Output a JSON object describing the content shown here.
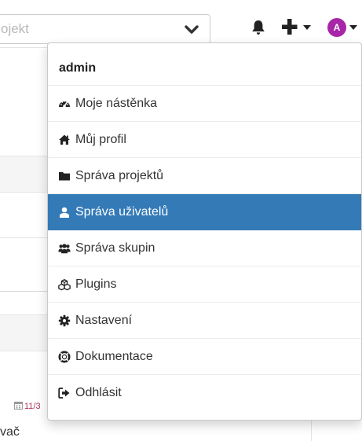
{
  "header": {
    "project_search": {
      "placeholder": "ojekt"
    },
    "avatar_initial": "A"
  },
  "background": {
    "date_fragment": "11/3",
    "text_fragment": "vač"
  },
  "user_menu": {
    "header": "admin",
    "items": [
      {
        "label": "Moje nástěnka",
        "icon": "dashboard-icon",
        "active": false
      },
      {
        "label": "Můj profil",
        "icon": "home-icon",
        "active": false
      },
      {
        "label": "Správa projektů",
        "icon": "folder-icon",
        "active": false
      },
      {
        "label": "Správa uživatelů",
        "icon": "user-icon",
        "active": true
      },
      {
        "label": "Správa skupin",
        "icon": "users-icon",
        "active": false
      },
      {
        "label": "Plugins",
        "icon": "cubes-icon",
        "active": false
      },
      {
        "label": "Nastavení",
        "icon": "gear-icon",
        "active": false
      },
      {
        "label": "Dokumentace",
        "icon": "life-ring-icon",
        "active": false
      },
      {
        "label": "Odhlásit",
        "icon": "sign-out-icon",
        "active": false
      }
    ]
  },
  "colors": {
    "accent": "#337ab7",
    "avatar": "#a726a8",
    "date_text": "#b03060"
  }
}
